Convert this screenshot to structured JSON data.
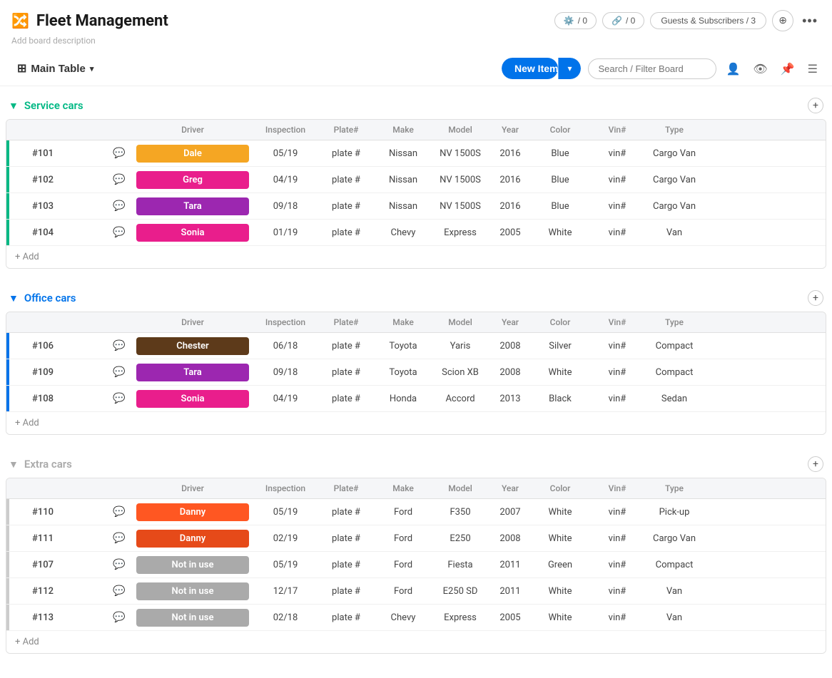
{
  "app": {
    "title": "Fleet Management",
    "description": "Add board description",
    "icon": "🔀"
  },
  "header": {
    "automation_count": "/ 0",
    "integration_count": "/ 0",
    "guests_label": "Guests & Subscribers / 3",
    "more_icon": "•••"
  },
  "toolbar": {
    "main_table_label": "Main Table",
    "new_item_label": "New Item",
    "search_placeholder": "Search / Filter Board"
  },
  "groups": [
    {
      "id": "service-cars",
      "title": "Service cars",
      "color": "green",
      "columns": [
        "Driver",
        "Inspection",
        "Plate#",
        "Make",
        "Model",
        "Year",
        "Color",
        "Vin#",
        "Type"
      ],
      "rows": [
        {
          "id": "#101",
          "driver": "Dale",
          "driver_color": "#f5a623",
          "inspection": "05/19",
          "plate": "plate #",
          "make": "Nissan",
          "model": "NV 1500S",
          "year": "2016",
          "color": "Blue",
          "vin": "vin#",
          "type": "Cargo Van"
        },
        {
          "id": "#102",
          "driver": "Greg",
          "driver_color": "#e91e8c",
          "inspection": "04/19",
          "plate": "plate #",
          "make": "Nissan",
          "model": "NV 1500S",
          "year": "2016",
          "color": "Blue",
          "vin": "vin#",
          "type": "Cargo Van"
        },
        {
          "id": "#103",
          "driver": "Tara",
          "driver_color": "#9c27b0",
          "inspection": "09/18",
          "plate": "plate #",
          "make": "Nissan",
          "model": "NV 1500S",
          "year": "2016",
          "color": "Blue",
          "vin": "vin#",
          "type": "Cargo Van"
        },
        {
          "id": "#104",
          "driver": "Sonia",
          "driver_color": "#e91e8c",
          "inspection": "01/19",
          "plate": "plate #",
          "make": "Chevy",
          "model": "Express",
          "year": "2005",
          "color": "White",
          "vin": "vin#",
          "type": "Van"
        }
      ],
      "add_label": "+ Add"
    },
    {
      "id": "office-cars",
      "title": "Office cars",
      "color": "blue",
      "columns": [
        "Driver",
        "Inspection",
        "Plate#",
        "Make",
        "Model",
        "Year",
        "Color",
        "Vin#",
        "Type"
      ],
      "rows": [
        {
          "id": "#106",
          "driver": "Chester",
          "driver_color": "#5d3a1a",
          "inspection": "06/18",
          "plate": "plate #",
          "make": "Toyota",
          "model": "Yaris",
          "year": "2008",
          "color": "Silver",
          "vin": "vin#",
          "type": "Compact"
        },
        {
          "id": "#109",
          "driver": "Tara",
          "driver_color": "#9c27b0",
          "inspection": "09/18",
          "plate": "plate #",
          "make": "Toyota",
          "model": "Scion XB",
          "year": "2008",
          "color": "White",
          "vin": "vin#",
          "type": "Compact"
        },
        {
          "id": "#108",
          "driver": "Sonia",
          "driver_color": "#e91e8c",
          "inspection": "04/19",
          "plate": "plate #",
          "make": "Honda",
          "model": "Accord",
          "year": "2013",
          "color": "Black",
          "vin": "vin#",
          "type": "Sedan"
        }
      ],
      "add_label": "+ Add"
    },
    {
      "id": "extra-cars",
      "title": "Extra cars",
      "color": "gray",
      "columns": [
        "Driver",
        "Inspection",
        "Plate#",
        "Make",
        "Model",
        "Year",
        "Color",
        "Vin#",
        "Type"
      ],
      "rows": [
        {
          "id": "#110",
          "driver": "Danny",
          "driver_color": "#ff5722",
          "inspection": "05/19",
          "plate": "plate #",
          "make": "Ford",
          "model": "F350",
          "year": "2007",
          "color": "White",
          "vin": "vin#",
          "type": "Pick-up"
        },
        {
          "id": "#111",
          "driver": "Danny",
          "driver_color": "#e64a19",
          "inspection": "02/19",
          "plate": "plate #",
          "make": "Ford",
          "model": "E250",
          "year": "2008",
          "color": "White",
          "vin": "vin#",
          "type": "Cargo Van"
        },
        {
          "id": "#107",
          "driver": "Not in use",
          "driver_color": "#aaa",
          "inspection": "05/19",
          "plate": "plate #",
          "make": "Ford",
          "model": "Fiesta",
          "year": "2011",
          "color": "Green",
          "vin": "vin#",
          "type": "Compact"
        },
        {
          "id": "#112",
          "driver": "Not in use",
          "driver_color": "#aaa",
          "inspection": "12/17",
          "plate": "plate #",
          "make": "Ford",
          "model": "E250 SD",
          "year": "2011",
          "color": "White",
          "vin": "vin#",
          "type": "Van"
        },
        {
          "id": "#113",
          "driver": "Not in use",
          "driver_color": "#aaa",
          "inspection": "02/18",
          "plate": "plate #",
          "make": "Chevy",
          "model": "Express",
          "year": "2005",
          "color": "White",
          "vin": "vin#",
          "type": "Van"
        }
      ],
      "add_label": "+ Add"
    }
  ]
}
